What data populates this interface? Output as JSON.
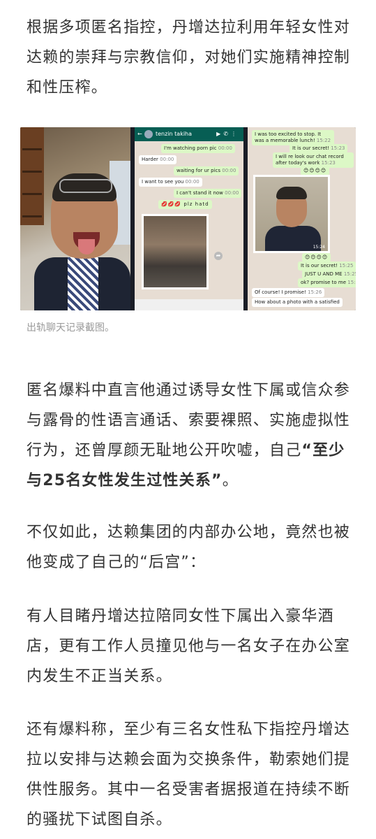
{
  "paragraphs": {
    "p1": "根据多项匿名指控，丹增达拉利用年轻女性对达赖的崇拜与宗教信仰，对她们实施精神控制和性压榨。",
    "p2_text": "匿名爆料中直言他通过诱导女性下属或信众参与露骨的性语言通话、索要裸照、实施虚拟性行为，还曾厚颜无耻地公开吹嘘，自己",
    "p2_bold": "“至少与25名女性发生过性关系”",
    "p2_end": "。",
    "p3": "不仅如此，达赖集团的内部办公地，竟然也被他变成了自己的“后宫”：",
    "p4": "有人目睹丹增达拉陪同女性下属出入豪华酒店，更有工作人员撞见他与一名女子在办公室内发生不正当关系。",
    "p5": "还有爆料称，至少有三名女性私下指控丹增达拉以安排与达赖会面为交换条件，勒索她们提供性服务。其中一名受害者据报道在持续不断的骚扰下试图自杀。"
  },
  "figure": {
    "caption": "出轨聊天记录截图。",
    "chat_left": {
      "contact": "tenzin takiha",
      "messages": [
        {
          "dir": "out",
          "text": "I'm watching porn pic",
          "time": "00:00"
        },
        {
          "dir": "in",
          "text": "Harder",
          "time": "00:00"
        },
        {
          "dir": "out",
          "text": "waiting for ur pics",
          "time": "00:00"
        },
        {
          "dir": "in",
          "text": "I want to see you",
          "time": "00:00"
        },
        {
          "dir": "out",
          "text": "I can't stand it now",
          "time": "00:00"
        },
        {
          "dir": "out",
          "text": "💋💋💋 plz hatd",
          "time": ""
        }
      ]
    },
    "chat_right": {
      "messages_top": [
        {
          "dir": "out",
          "text": "I was too excited to stop. It was a memorable lunch!",
          "time": "15:22"
        },
        {
          "dir": "out",
          "text": "It is our secret!",
          "time": "15:23"
        },
        {
          "dir": "out",
          "text": "I will re look our chat record after today's work",
          "time": "15:23"
        },
        {
          "dir": "out",
          "text": "😊😊😊😊",
          "time": "15:23"
        }
      ],
      "selfie_time": "15:24",
      "messages_bottom": [
        {
          "dir": "out",
          "text": "😊😊😊😊",
          "time": "15:24"
        },
        {
          "dir": "out",
          "text": "It is our secret!",
          "time": "15:25"
        },
        {
          "dir": "out",
          "text": "JUST U AND ME",
          "time": "15:25"
        },
        {
          "dir": "out",
          "text": "ok? promise to me",
          "time": "15:25"
        },
        {
          "dir": "in",
          "text": "Of course! I promise!",
          "time": "15:26"
        },
        {
          "dir": "in",
          "text": "How about a photo with a satisfied",
          "time": "15:26"
        }
      ]
    }
  },
  "colors": {
    "text": "#333333",
    "caption": "#999999",
    "whatsapp_header": "#075e54",
    "bubble_out": "#dcf8c6",
    "chat_bg": "#e7ddd3"
  }
}
